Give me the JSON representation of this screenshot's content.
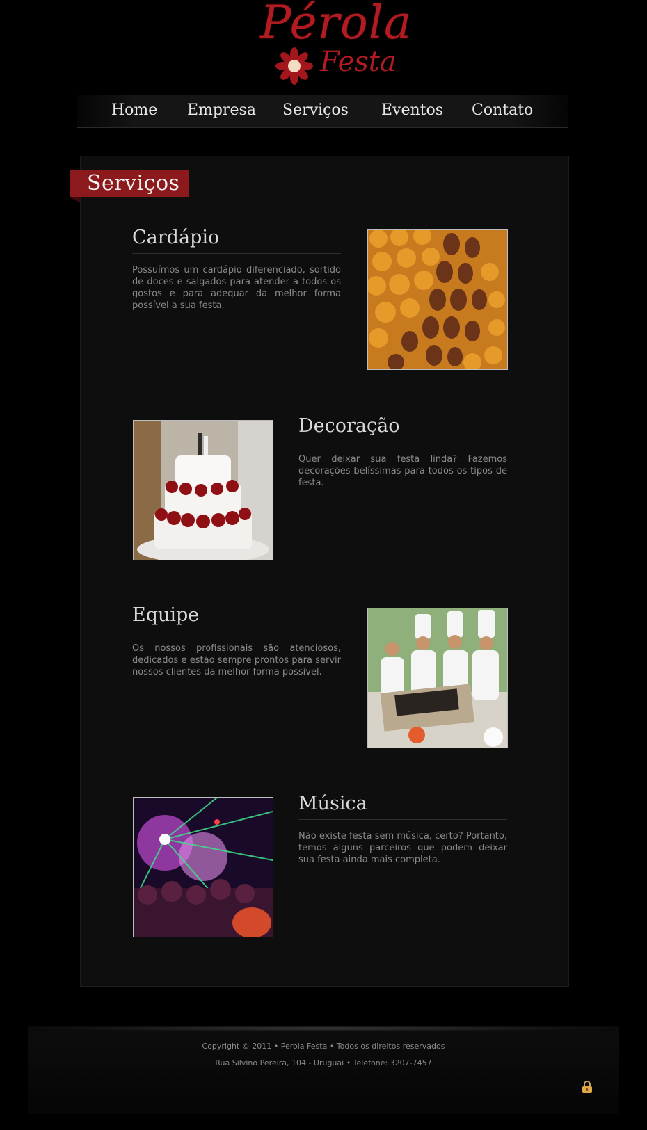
{
  "logo": {
    "line1": "Pérola",
    "line2": "Festa"
  },
  "nav": [
    {
      "label": "Home"
    },
    {
      "label": "Empresa"
    },
    {
      "label": "Serviços"
    },
    {
      "label": "Eventos"
    },
    {
      "label": "Contato"
    }
  ],
  "page_title": "Serviços",
  "services": [
    {
      "title": "Cardápio",
      "text": "Possuímos um cardápio diferenciado, sortido de doces e salgados para atender a todos os gostos e para adequar da melhor forma possível a sua festa.",
      "image_icon": "savory-snacks-photo"
    },
    {
      "title": "Decoração",
      "text": "Quer deixar sua festa linda? Fazemos decorações belíssimas para todos os tipos de festa.",
      "image_icon": "wedding-cake-photo"
    },
    {
      "title": "Equipe",
      "text": "Os nossos profissionais são atenciosos, dedicados e estão sempre prontos para servir nossos clientes da melhor forma possível.",
      "image_icon": "chef-team-photo"
    },
    {
      "title": "Música",
      "text": "Não existe festa sem música, certo? Portanto, temos alguns parceiros que podem deixar sua festa ainda mais completa.",
      "image_icon": "party-lights-photo"
    }
  ],
  "footer": {
    "line1": "Copyright © 2011 • Perola Festa • Todos os direitos reservados",
    "line2": "Rua Silvino Pereira, 104 - Uruguai • Telefone: 3207-7457"
  },
  "colors": {
    "brand_red": "#8c1a1d",
    "logo_red": "#b01c22",
    "background": "#000000",
    "panel": "#0e0e0e"
  }
}
